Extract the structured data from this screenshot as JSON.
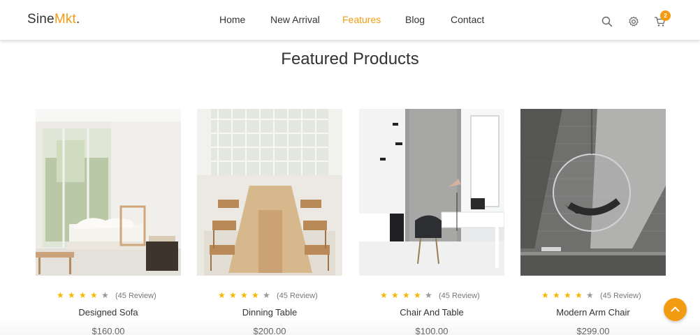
{
  "brand": {
    "name": "Sine",
    "accent": "Mkt",
    "dot": ".",
    "accent_color": "#f39c12"
  },
  "nav": {
    "items": [
      {
        "label": "Home"
      },
      {
        "label": "New Arrival"
      },
      {
        "label": "Features",
        "active": true
      },
      {
        "label": "Blog"
      },
      {
        "label": "Contact"
      }
    ]
  },
  "header_icons": [
    "search-icon",
    "gear-icon",
    "cart-icon"
  ],
  "cart": {
    "count": "2"
  },
  "section": {
    "title": "Featured Products"
  },
  "products": [
    {
      "name": "Designed Sofa",
      "price": "$160.00",
      "rating": 4,
      "reviews": "(45 Review)"
    },
    {
      "name": "Dinning Table",
      "price": "$200.00",
      "rating": 4,
      "reviews": "(45 Review)"
    },
    {
      "name": "Chair And Table",
      "price": "$100.00",
      "rating": 4,
      "reviews": "(45 Review)"
    },
    {
      "name": "Modern Arm Chair",
      "price": "$299.00",
      "rating": 4,
      "reviews": "(45 Review)"
    }
  ],
  "scroll_top": {
    "icon": "chevron-up-icon"
  }
}
